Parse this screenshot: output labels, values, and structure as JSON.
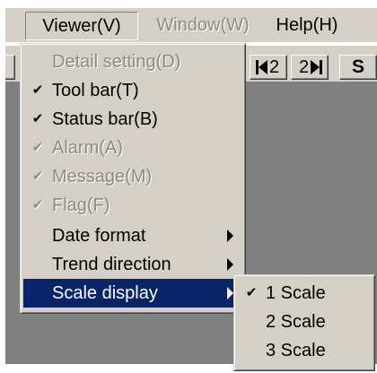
{
  "menubar": {
    "viewer": "Viewer(V)",
    "window": "Window(W)",
    "help": "Help(H)"
  },
  "toolbar": {
    "prev2_digit": "2",
    "next2_digit": "2",
    "s_button": "S"
  },
  "viewer_menu": {
    "items": [
      {
        "label": "Detail setting(D)",
        "checked": false,
        "enabled": false,
        "submenu": false
      },
      {
        "label": "Tool bar(T)",
        "checked": true,
        "enabled": true,
        "submenu": false
      },
      {
        "label": "Status bar(B)",
        "checked": true,
        "enabled": true,
        "submenu": false
      },
      {
        "label": "Alarm(A)",
        "checked": true,
        "enabled": false,
        "submenu": false
      },
      {
        "label": "Message(M)",
        "checked": true,
        "enabled": false,
        "submenu": false
      },
      {
        "label": "Flag(F)",
        "checked": true,
        "enabled": false,
        "submenu": false
      },
      {
        "label": "Date format",
        "checked": false,
        "enabled": true,
        "submenu": true
      },
      {
        "label": "Trend direction",
        "checked": false,
        "enabled": true,
        "submenu": true
      },
      {
        "label": "Scale display",
        "checked": false,
        "enabled": true,
        "submenu": true,
        "highlighted": true
      }
    ],
    "check_glyph": "✔"
  },
  "scale_submenu": {
    "items": [
      {
        "label": "1 Scale",
        "checked": true
      },
      {
        "label": "2 Scale",
        "checked": false
      },
      {
        "label": "3 Scale",
        "checked": false
      }
    ]
  },
  "colors": {
    "face": "#d4d0c8",
    "highlight": "#0a246a",
    "workspace": "#808080",
    "disabled_text": "#8c8a86"
  }
}
